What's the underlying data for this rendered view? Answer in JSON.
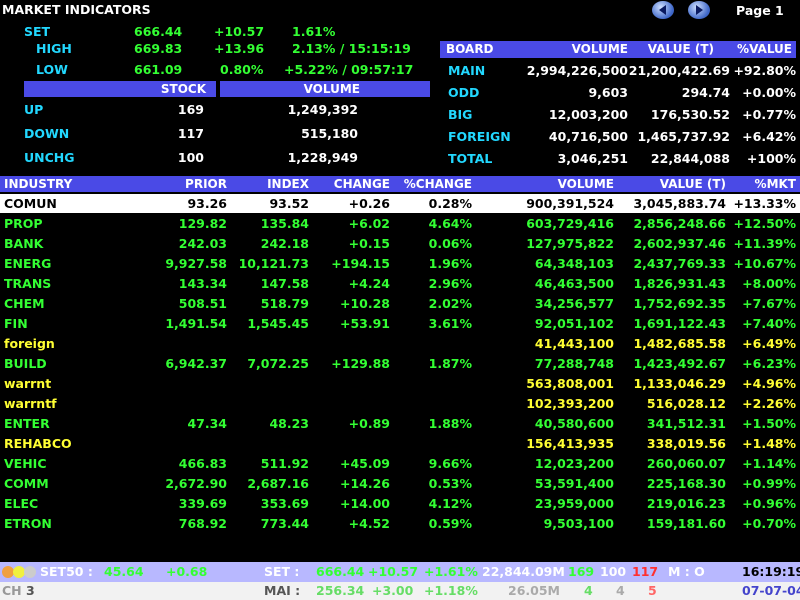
{
  "title": "MARKET INDICATORS",
  "page_label": "Page 1",
  "summary": {
    "set": {
      "label": "SET",
      "value": "666.44",
      "change": "+10.57",
      "pct": "1.61%"
    },
    "high": {
      "label": "HIGH",
      "value": "669.83",
      "change": "+13.96",
      "pct": "2.13% / 15:15:19"
    },
    "low": {
      "label": "LOW",
      "value": "661.09",
      "change": "0.80%",
      "pct": "+5.22% / 09:57:17"
    }
  },
  "stock_table": {
    "headers": [
      "STOCK",
      "VOLUME"
    ],
    "rows": [
      {
        "label": "UP",
        "stock": "169",
        "volume": "1,249,392"
      },
      {
        "label": "DOWN",
        "stock": "117",
        "volume": "515,180"
      },
      {
        "label": "UNCHG",
        "stock": "100",
        "volume": "1,228,949"
      }
    ]
  },
  "board_table": {
    "headers": [
      "BOARD",
      "VOLUME",
      "VALUE (T)",
      "%VALUE"
    ],
    "rows": [
      {
        "board": "MAIN",
        "volume": "2,994,226,500",
        "value": "21,200,422.69",
        "pct": "+92.80%"
      },
      {
        "board": "ODD",
        "volume": "9,603",
        "value": "294.74",
        "pct": "+0.00%"
      },
      {
        "board": "BIG",
        "volume": "12,003,200",
        "value": "176,530.52",
        "pct": "+0.77%"
      },
      {
        "board": "FOREIGN",
        "volume": "40,716,500",
        "value": "1,465,737.92",
        "pct": "+6.42%"
      },
      {
        "board": "TOTAL",
        "volume": "3,046,251",
        "value": "22,844,088",
        "pct": "+100%"
      }
    ]
  },
  "industry_table": {
    "headers": [
      "INDUSTRY",
      "PRIOR",
      "INDEX",
      "CHANGE",
      "%CHANGE",
      "VOLUME",
      "VALUE (T)",
      "%MKT"
    ],
    "rows": [
      {
        "name": "COMUN",
        "prior": "93.26",
        "index": "93.52",
        "change": "+0.26",
        "pct": "0.28%",
        "volume": "900,391,524",
        "value": "3,045,883.74",
        "mkt": "+13.33%",
        "style": "highlight"
      },
      {
        "name": "PROP",
        "prior": "129.82",
        "index": "135.84",
        "change": "+6.02",
        "pct": "4.64%",
        "volume": "603,729,416",
        "value": "2,856,248.66",
        "mkt": "+12.50%",
        "style": "green"
      },
      {
        "name": "BANK",
        "prior": "242.03",
        "index": "242.18",
        "change": "+0.15",
        "pct": "0.06%",
        "volume": "127,975,822",
        "value": "2,602,937.46",
        "mkt": "+11.39%",
        "style": "green"
      },
      {
        "name": "ENERG",
        "prior": "9,927.58",
        "index": "10,121.73",
        "change": "+194.15",
        "pct": "1.96%",
        "volume": "64,348,103",
        "value": "2,437,769.33",
        "mkt": "+10.67%",
        "style": "green"
      },
      {
        "name": "TRANS",
        "prior": "143.34",
        "index": "147.58",
        "change": "+4.24",
        "pct": "2.96%",
        "volume": "46,463,500",
        "value": "1,826,931.43",
        "mkt": "+8.00%",
        "style": "green"
      },
      {
        "name": "CHEM",
        "prior": "508.51",
        "index": "518.79",
        "change": "+10.28",
        "pct": "2.02%",
        "volume": "34,256,577",
        "value": "1,752,692.35",
        "mkt": "+7.67%",
        "style": "green"
      },
      {
        "name": "FIN",
        "prior": "1,491.54",
        "index": "1,545.45",
        "change": "+53.91",
        "pct": "3.61%",
        "volume": "92,051,102",
        "value": "1,691,122.43",
        "mkt": "+7.40%",
        "style": "green"
      },
      {
        "name": "foreign",
        "prior": "",
        "index": "",
        "change": "",
        "pct": "",
        "volume": "41,443,100",
        "value": "1,482,685.58",
        "mkt": "+6.49%",
        "style": "yellow"
      },
      {
        "name": "BUILD",
        "prior": "6,942.37",
        "index": "7,072.25",
        "change": "+129.88",
        "pct": "1.87%",
        "volume": "77,288,748",
        "value": "1,423,492.67",
        "mkt": "+6.23%",
        "style": "green"
      },
      {
        "name": "warrnt",
        "prior": "",
        "index": "",
        "change": "",
        "pct": "",
        "volume": "563,808,001",
        "value": "1,133,046.29",
        "mkt": "+4.96%",
        "style": "yellow"
      },
      {
        "name": "warrntf",
        "prior": "",
        "index": "",
        "change": "",
        "pct": "",
        "volume": "102,393,200",
        "value": "516,028.12",
        "mkt": "+2.26%",
        "style": "yellow"
      },
      {
        "name": "ENTER",
        "prior": "47.34",
        "index": "48.23",
        "change": "+0.89",
        "pct": "1.88%",
        "volume": "40,580,600",
        "value": "341,512.31",
        "mkt": "+1.50%",
        "style": "green"
      },
      {
        "name": "REHABCO",
        "prior": "",
        "index": "",
        "change": "",
        "pct": "",
        "volume": "156,413,935",
        "value": "338,019.56",
        "mkt": "+1.48%",
        "style": "yellow"
      },
      {
        "name": "VEHIC",
        "prior": "466.83",
        "index": "511.92",
        "change": "+45.09",
        "pct": "9.66%",
        "volume": "12,023,200",
        "value": "260,060.07",
        "mkt": "+1.14%",
        "style": "green"
      },
      {
        "name": "COMM",
        "prior": "2,672.90",
        "index": "2,687.16",
        "change": "+14.26",
        "pct": "0.53%",
        "volume": "53,591,400",
        "value": "225,168.30",
        "mkt": "+0.99%",
        "style": "green"
      },
      {
        "name": "ELEC",
        "prior": "339.69",
        "index": "353.69",
        "change": "+14.00",
        "pct": "4.12%",
        "volume": "23,959,000",
        "value": "219,016.23",
        "mkt": "+0.96%",
        "style": "green"
      },
      {
        "name": "ETRON",
        "prior": "768.92",
        "index": "773.44",
        "change": "+4.52",
        "pct": "0.59%",
        "volume": "9,503,100",
        "value": "159,181.60",
        "mkt": "+0.70%",
        "style": "green"
      }
    ]
  },
  "status_bar": {
    "set50_label": "SET50 :",
    "set50_value": "45.64",
    "set50_change": "+0.68",
    "set_label": "SET :",
    "set_value": "666.44",
    "set_change": "+10.57",
    "set_pct": "+1.61%",
    "set_turnover": "22,844.09M",
    "up": "169",
    "unchg": "100",
    "down": "117",
    "mode": "M : O",
    "time": "16:19:19",
    "ch_label": "CH",
    "ch_value": "3",
    "mai_label": "MAI :",
    "mai_value": "256.34",
    "mai_change": "+3.00",
    "mai_pct": "+1.18%",
    "mai_turnover": "26.05M",
    "mai_up": "4",
    "mai_unchg": "4",
    "mai_down": "5",
    "date": "07-07-04"
  },
  "colors": {
    "header_bar": "#4a4ae6",
    "status_bar": "#b8b8ff",
    "up": "#33ff33",
    "label": "#22d8ff",
    "yellow": "#ffff33"
  }
}
